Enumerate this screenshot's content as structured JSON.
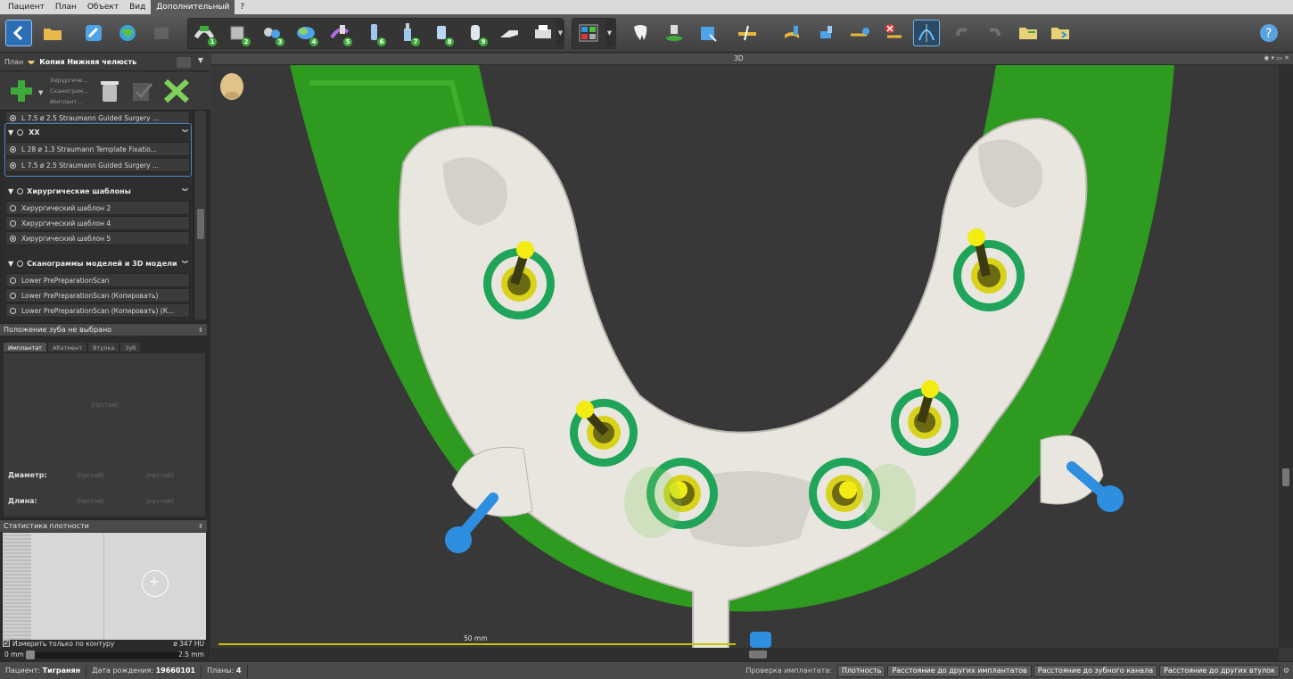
{
  "menu": {
    "items": [
      {
        "label": "Пациент"
      },
      {
        "label": "План"
      },
      {
        "label": "Объект"
      },
      {
        "label": "Вид"
      },
      {
        "label": "Дополнительный",
        "active": true
      },
      {
        "label": "?"
      }
    ]
  },
  "toolbar": {
    "numbered_tools": [
      "1",
      "2",
      "3",
      "4",
      "5",
      "6",
      "7",
      "8",
      "9"
    ],
    "accent": "#3faa3a"
  },
  "left_panel": {
    "plan_label": "План",
    "plan_name": "Копия Нижняя челюсть",
    "mini_labels": [
      "Хирургиче...",
      "Сканограм...",
      "Имплант..."
    ],
    "tree": {
      "row0": {
        "text": "L 7.5  ø 2.5   Straumann Guided Surgery ..."
      },
      "group_xx": {
        "label": "XX"
      },
      "xx_rows": [
        {
          "text": "L 28  ø 1.3   Straumann Template Fixatio..."
        },
        {
          "text": "L 7.5  ø 2.5   Straumann Guided Surgery ..."
        }
      ],
      "templates_header": "Хирургические шаблоны",
      "templates": [
        {
          "label": "Хирургический шаблон 2",
          "selected": false
        },
        {
          "label": "Хирургический шаблон 4",
          "selected": false
        },
        {
          "label": "Хирургический шаблон 5",
          "selected": true
        }
      ],
      "scans_header": "Сканограммы моделей и 3D модели",
      "scans": [
        {
          "label": "Lower PrePreparationScan"
        },
        {
          "label": "Lower PrePreparationScan (Копировать)"
        },
        {
          "label": "Lower PrePreparationScan (Копировать) (К..."
        }
      ]
    },
    "tooth_section": "Положение зуба не выбрано",
    "tabs": [
      "Имплантат",
      "Абатмент",
      "Втулка",
      "Зуб"
    ],
    "empty_text": "(пустой)",
    "diameter_label": "Диаметр:",
    "length_label": "Длина:",
    "empty_val": "(пустой)",
    "density_section": "Статистика плотности",
    "measure_label": "Измерить только по контуру",
    "hu_value": "ø 347 HU",
    "range_min": "0 mm",
    "range_max": "2.5 mm"
  },
  "viewport": {
    "title": "3D",
    "scale_label": "50 mm",
    "colors": {
      "bone": "#2e9a1f",
      "guide": "#e8e6df",
      "sleeve_ring": "#1fa45a",
      "implant": "#f2ec12",
      "pin": "#2e8fe0"
    }
  },
  "statusbar": {
    "patient_label": "Пациент:",
    "patient_value": "Тигранян",
    "dob_label": "Дата рождения:",
    "dob_value": "19660101",
    "plans_label": "Планы:",
    "plans_value": "4",
    "check_label": "Проверка имплантата:",
    "buttons": [
      "Плотность",
      "Расстояние до других имплантатов",
      "Расстояние до зубного канала",
      "Расстояние до других втулок"
    ]
  }
}
